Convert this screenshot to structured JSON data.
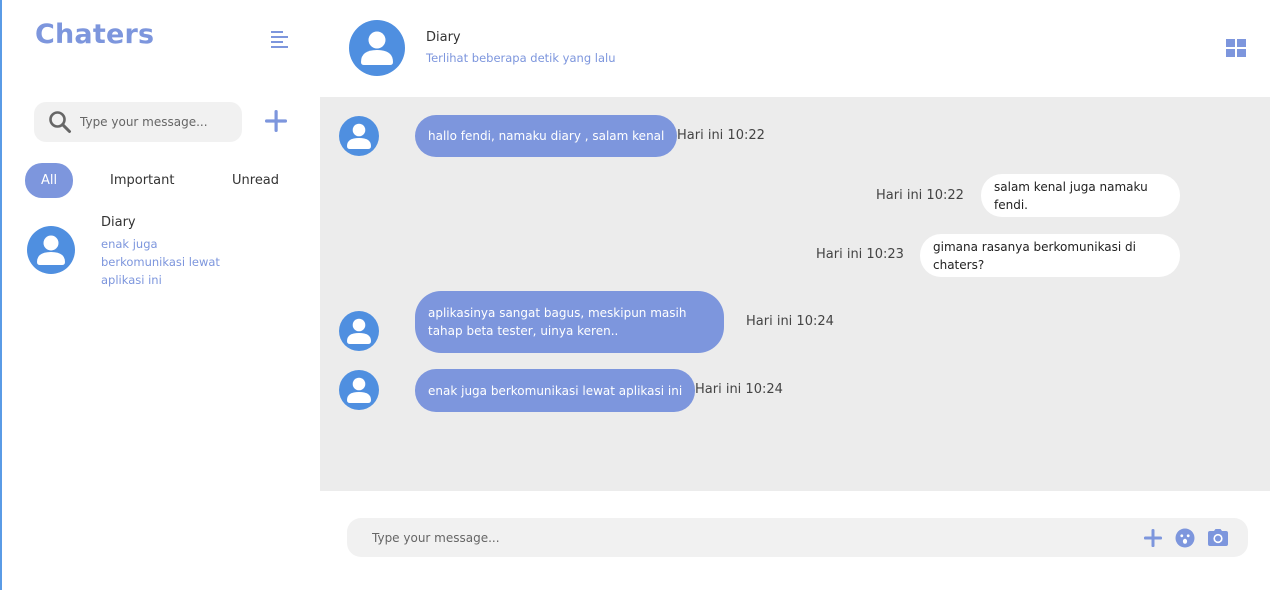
{
  "app": {
    "brand": "Chaters"
  },
  "sidebar": {
    "search": {
      "placeholder": "Type your message..."
    },
    "filters": {
      "all": "All",
      "important": "Important",
      "unread": "Unread"
    },
    "conversations": [
      {
        "name": "Diary",
        "preview": "enak juga berkomunikasi lewat aplikasi ini"
      }
    ]
  },
  "header": {
    "name": "Diary",
    "status": "Terlihat beberapa detik yang lalu"
  },
  "messages": [
    {
      "direction": "in",
      "text": "hallo fendi, namaku diary , salam kenal",
      "time": "Hari ini 10:22"
    },
    {
      "direction": "out",
      "text": "salam kenal juga namaku fendi.",
      "time": "Hari ini 10:22"
    },
    {
      "direction": "out",
      "text": "gimana rasanya berkomunikasi di chaters?",
      "time": "Hari ini 10:23"
    },
    {
      "direction": "in",
      "text": "aplikasinya sangat bagus, meskipun masih tahap beta tester, uinya keren..",
      "time": "Hari ini 10:24"
    },
    {
      "direction": "in",
      "text": "enak juga berkomunikasi lewat aplikasi ini",
      "time": "Hari ini 10:24"
    }
  ],
  "composer": {
    "placeholder": "Type your message..."
  },
  "icons": {
    "menu": "menu-lines-icon",
    "search": "search-icon",
    "add": "plus-icon",
    "grid": "grid-icon",
    "emoji": "emoji-icon",
    "camera": "camera-icon",
    "avatar": "user-avatar-icon"
  },
  "colors": {
    "accent": "#7d96dd",
    "avatar": "#4f8fe0",
    "chat_bg": "#ececec",
    "input_bg": "#f1f1f1"
  }
}
